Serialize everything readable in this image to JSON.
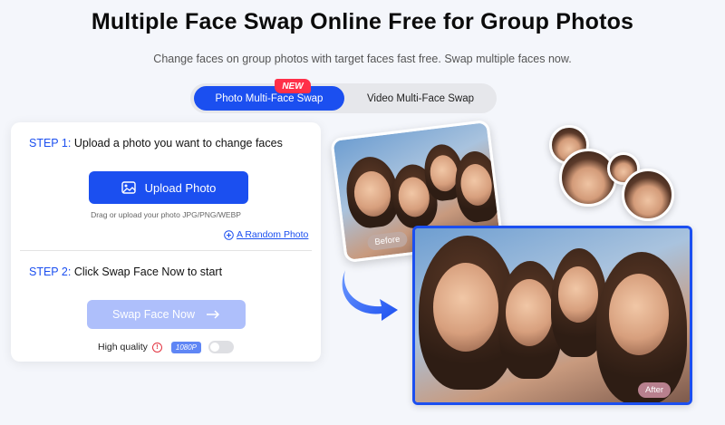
{
  "header": {
    "title": "Multiple Face Swap Online Free for Group Photos",
    "subtitle": "Change faces on group photos with target faces fast free. Swap multiple faces now."
  },
  "tabs": [
    {
      "label": "Photo Multi-Face Swap",
      "active": true
    },
    {
      "label": "Video Multi-Face Swap",
      "active": false
    }
  ],
  "new_badge": "NEW",
  "step1": {
    "number": "STEP 1:",
    "text": "Upload a photo you want to change faces",
    "upload_button": "Upload Photo",
    "hint": "Drag or upload your photo JPG/PNG/WEBP",
    "random_link": "A Random Photo"
  },
  "step2": {
    "number": "STEP 2:",
    "text": "Click Swap Face Now to start",
    "swap_button": "Swap Face Now",
    "quality_label": "High quality",
    "quality_badge": "1080P",
    "quality_enabled": false
  },
  "preview": {
    "before_label": "Before",
    "after_label": "After"
  },
  "colors": {
    "accent": "#1b4ff0",
    "accent_disabled": "#aebffb",
    "badge_red": "#ff2f49"
  },
  "icons": [
    "image-icon",
    "plus-circle-icon",
    "arrow-right-icon",
    "info-icon",
    "curved-arrow-icon"
  ]
}
